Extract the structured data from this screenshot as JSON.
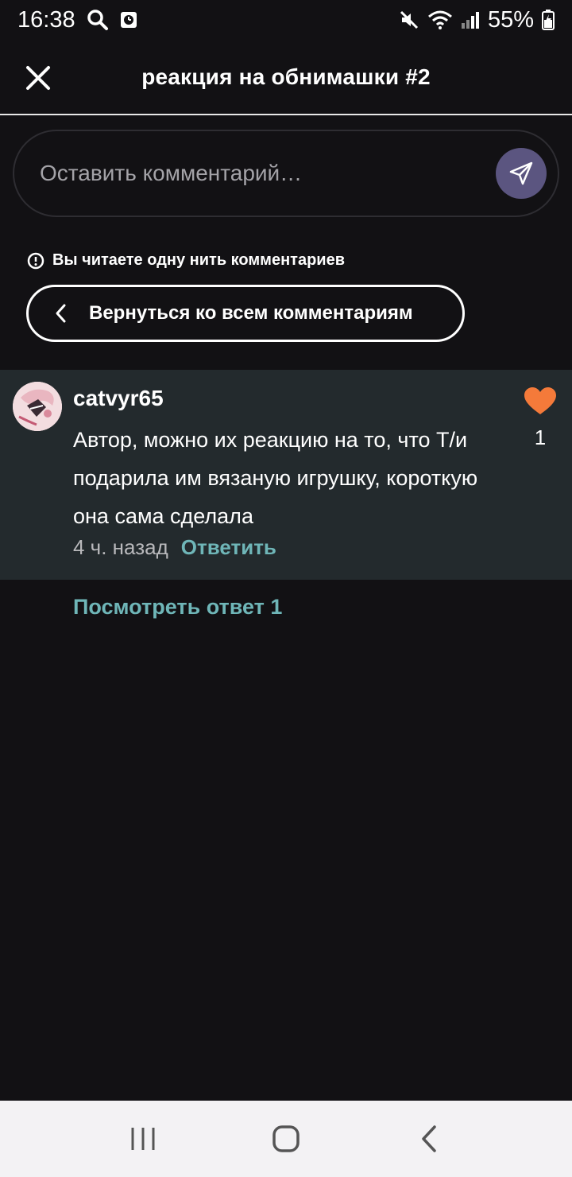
{
  "status_bar": {
    "time": "16:38",
    "battery": "55%"
  },
  "header": {
    "title": "реакция на обнимашки #2"
  },
  "comment_input": {
    "placeholder": "Оставить комментарий…"
  },
  "thread": {
    "notice": "Вы читаете одну нить комментариев",
    "back_label": "Вернуться ко всем комментариям"
  },
  "comment": {
    "username": "catvyr65",
    "text": "Автор, можно их реакцию на то, что Т/и подарила им вязаную игрушку, короткую она сама сделала",
    "time": "4 ч. назад",
    "reply_label": "Ответить",
    "likes": "1",
    "like_color": "#f47a3a"
  },
  "view_replies": "Посмотреть ответ 1",
  "colors": {
    "background": "#121114",
    "card": "#232a2d",
    "accent": "#6fb6b8",
    "send_button": "#5b5580"
  }
}
